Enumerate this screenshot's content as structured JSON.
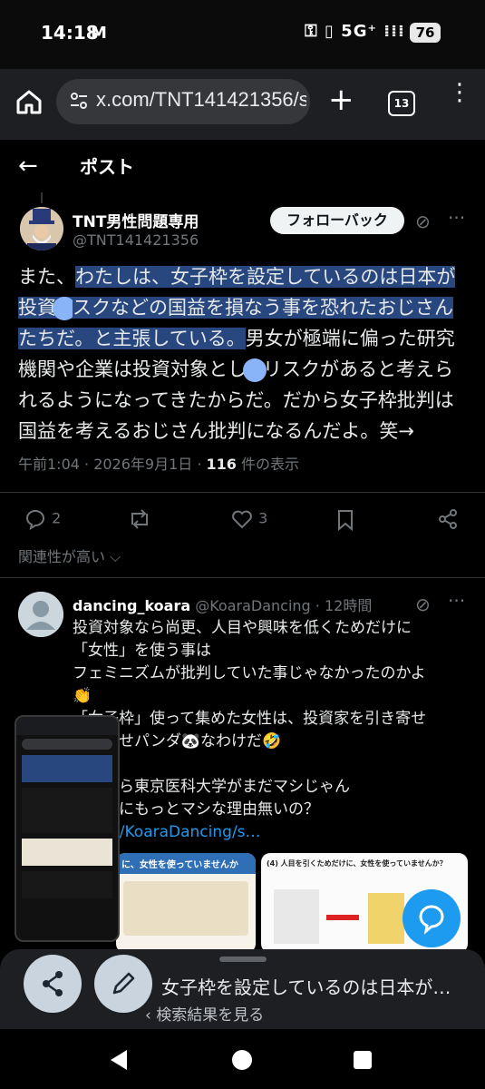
{
  "status_bar": {
    "time": "14:18",
    "mail_icon": "M",
    "signal_text": "5G⁺",
    "battery": "76"
  },
  "browser": {
    "url": "x.com/TNT141421356/sta",
    "tab_count": "13",
    "new_tab": "+",
    "menu": "⋮"
  },
  "header": {
    "back": "←",
    "title": "ポスト"
  },
  "post": {
    "author_name": "TNT男性問題専用",
    "author_handle": "@TNT141421356",
    "follow_label": "フォローバック",
    "text_lead": "また、",
    "text_highlight_1": "わたしは、女子枠を設定しているのは日本が投資",
    "text_highlight_2": "スクなどの国益を損なう事を恐れたおじさんたちだ。と主張している。",
    "text_rest_1": "男女が極端に偏った研究機関や企業は投資対象とし",
    "text_rest_2": "リスクがあると考えられるようになってきたからだ。だから女子枠批判は国益を考えるおじさん批判になるんだよ。笑→",
    "timestamp": "午前1:04 · 2026年9月1日 · ",
    "views_count": "116",
    "views_label": " 件の表示",
    "replies": "2",
    "likes": "3",
    "related_label": "関連性が高い"
  },
  "reply": {
    "author_name": "dancing_koara",
    "author_handle": "@KoaraDancing · 12時間",
    "line1": "投資対象なら尚更、人目や興味を低くためだけに",
    "line2": "「女性」を使う事は",
    "line3": "フェミニズムが批判していた事じゃなかったのかよ",
    "line4": "👏",
    "line5": "「女子枠」使って集めた女性は、投資家を引き寄せ",
    "line6": "る客寄せパンダ🐼なわけだ🤣",
    "line7": "",
    "line8": "それなら東京医科大学がまだマシじゃん",
    "line9": "女子枠にもっとマシな理由無いの？",
    "link": "x.com/KoaraDancing/s…",
    "img1_caption": "に、女性を使っていませんか",
    "img2_caption": "(4) 人目を引くためだけに、女性を使っていませんか？"
  },
  "sheet": {
    "title": "女子枠を設定しているのは日本が…",
    "subtitle": "検索結果を見る"
  },
  "colors": {
    "accent": "#1d9bf0",
    "highlight": "#27477e",
    "background": "#000000"
  }
}
